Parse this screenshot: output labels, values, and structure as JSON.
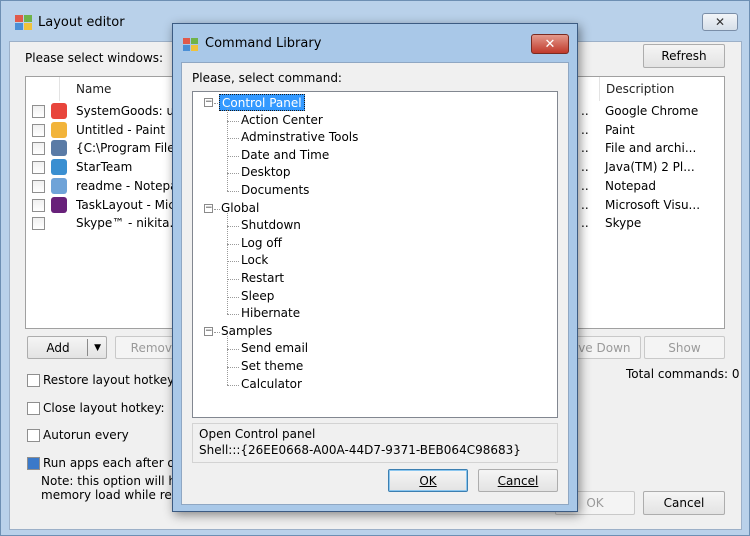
{
  "main": {
    "title": "Layout editor",
    "close_glyph": "✕",
    "select_windows_label": "Please select windows:",
    "refresh_label": "Refresh",
    "columns": {
      "name": "Name",
      "description": "Description"
    },
    "rows": [
      {
        "name": "SystemGoods: unic",
        "description": "Google Chrome",
        "icon": "chrome-icon",
        "icon_color": "#e8453c"
      },
      {
        "name": "Untitled - Paint",
        "description": "Paint",
        "icon": "paint-icon",
        "icon_color": "#f2b43a"
      },
      {
        "name": "{C:\\Program Files\\",
        "description": "File and archi...",
        "icon": "archive-icon",
        "icon_color": "#5a7ba6"
      },
      {
        "name": "StarTeam",
        "description": "Java(TM) 2 Pl...",
        "icon": "starteam-icon",
        "icon_color": "#3a8fd1"
      },
      {
        "name": "readme - Notepad",
        "description": "Notepad",
        "icon": "notepad-icon",
        "icon_color": "#6fa3d8"
      },
      {
        "name": "TaskLayout - Micro",
        "description": "Microsoft Visu...",
        "icon": "visual-studio-icon",
        "icon_color": "#68217a"
      },
      {
        "name": "Skype™ - nikita.po",
        "description": "Skype",
        "icon": "",
        "icon_color": ""
      }
    ],
    "row_ellipsis": "..",
    "add_label": "Add",
    "remove_label": "Remove",
    "move_down_label": "Move Down",
    "show_label": "Show",
    "total_commands": "Total commands: 0",
    "restore_hotkey_label": "Restore layout hotkey:",
    "close_hotkey_label": "Close layout hotkey:",
    "autorun_label": "Autorun every",
    "run_apps_label": "Run apps each after othe",
    "note_line1": "Note: this option will help",
    "note_line2": "memory load while restor",
    "ok_label": "OK",
    "cancel_label": "Cancel"
  },
  "dialog": {
    "title": "Command Library",
    "close_glyph": "✕",
    "select_label": "Please, select command:",
    "tree": [
      {
        "label": "Control Panel",
        "children": [
          "Action Center",
          "Adminstrative Tools",
          "Date and Time",
          "Desktop",
          "Documents"
        ]
      },
      {
        "label": "Global",
        "children": [
          "Shutdown",
          "Log off",
          "Lock",
          "Restart",
          "Sleep",
          "Hibernate"
        ]
      },
      {
        "label": "Samples",
        "children": [
          "Send email",
          "Set theme",
          "Calculator"
        ]
      }
    ],
    "selected": "Control Panel",
    "info_line1": "Open Control panel",
    "info_line2": "Shell:::{26EE0668-A00A-44D7-9371-BEB064C98683}",
    "ok_label": "OK",
    "cancel_label": "Cancel"
  },
  "colors": {
    "selection": "#3399ff",
    "titlebar": "#b9d1ea",
    "dialog_close": "#c0392b"
  }
}
